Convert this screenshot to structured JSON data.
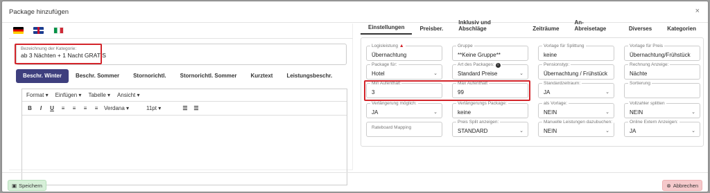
{
  "modal": {
    "title": "Package hinzufügen",
    "close_icon": "×"
  },
  "languages": [
    "de-flag-icon",
    "gb-flag-icon",
    "it-flag-icon"
  ],
  "category": {
    "label": "Bezeichnung der Kategorie:",
    "value": "ab 3 Nächten + 1 Nacht GRATIS"
  },
  "description_tabs": [
    "Beschr. Winter",
    "Beschr. Sommer",
    "Stornorichtl.",
    "Stornorichtl. Sommer",
    "Kurztext",
    "Leistungsbeschr."
  ],
  "editor": {
    "menu": [
      "Format",
      "Einfügen",
      "Tabelle",
      "Ansicht"
    ],
    "font": "Verdana",
    "size": "11pt"
  },
  "main_tabs": [
    "Einstellungen",
    "Preisber.",
    "Inklusiv und Abschläge",
    "Zeiträume",
    "An-Abreisetage",
    "Diverses",
    "Kategorien"
  ],
  "fields": {
    "logisleistung": {
      "label": "Logisleistung",
      "value": "Übernachtung"
    },
    "gruppe": {
      "label": "Gruppe",
      "value": "**Keine Gruppe**"
    },
    "vorlage_splitt": {
      "label": "Vorlage für Splittung",
      "value": "keine"
    },
    "vorlage_preis": {
      "label": "Vorlage für Preis",
      "value": "Übernachtung/Frühstück"
    },
    "package_fuer": {
      "label": "Package für:",
      "value": "Hotel"
    },
    "art_package": {
      "label": "Art des Packages:",
      "value": "Standard Preise"
    },
    "pensionstyp": {
      "label": "Pensionstyp:",
      "value": "Übernachtung / Frühstück"
    },
    "rechnung_anzeige": {
      "label": "Rechnung Anzeige:",
      "value": "Nächte"
    },
    "min_aufenthalt": {
      "label": "Min Aufenthalt",
      "value": "3"
    },
    "max_aufenthalt": {
      "label": "Max Aufenthalt",
      "value": "99"
    },
    "standardzeitraum": {
      "label": "Standardzeitraum:",
      "value": "JA"
    },
    "sortierung": {
      "label": "Sortierung",
      "value": ""
    },
    "verlaengerung_moeglich": {
      "label": "Verlängerung möglich:",
      "value": "JA"
    },
    "verlaengerungs_package": {
      "label": "Verlängerungs Package:",
      "value": "keine"
    },
    "als_vorlage": {
      "label": "als Vorlage:",
      "value": "NEIN"
    },
    "vollzahler_splitten": {
      "label": "Vollzahler splitten",
      "value": "NEIN"
    },
    "rateboard_mapping": {
      "label": "Rateboard Mapping",
      "value": ""
    },
    "preis_split": {
      "label": "Preis Split anzeigen:",
      "value": "STANDARD"
    },
    "manuelle_leistungen": {
      "label": "Manuelle Leistungen dazubuchen:",
      "value": "NEIN"
    },
    "online_extern": {
      "label": "Online Extern Anzeigen:",
      "value": "JA"
    }
  },
  "footer": {
    "save": "Speichern",
    "cancel": "Abbrechen"
  },
  "colors": {
    "accent": "#3e3f7e",
    "highlight": "#d3242a",
    "save_bg": "#d6efd8",
    "cancel_bg": "#f5c9cb"
  }
}
